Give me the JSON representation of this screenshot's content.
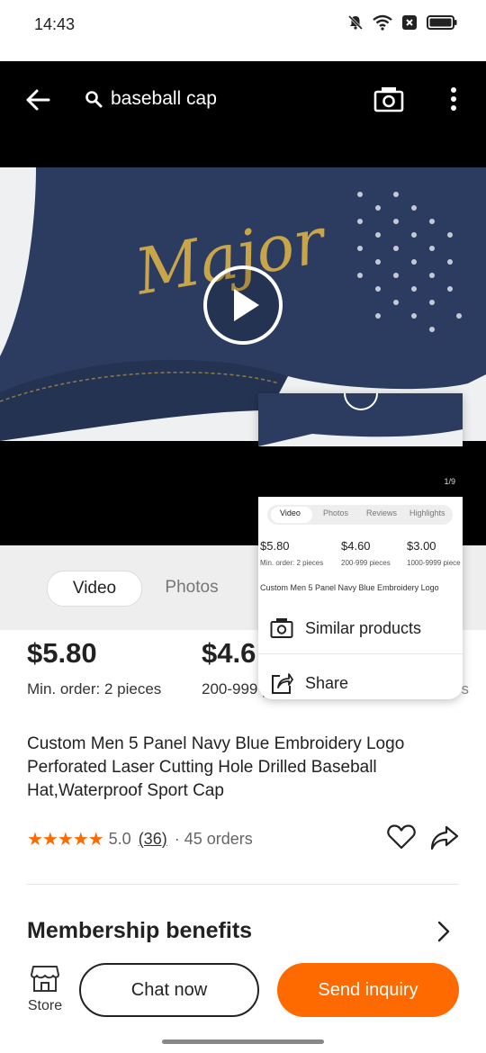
{
  "status_bar": {
    "time": "14:43"
  },
  "search": {
    "query": "baseball cap"
  },
  "hero": {
    "script_text": "Major",
    "page_indicator": "1/9"
  },
  "tabs": {
    "video": "Video",
    "photos": "Photos"
  },
  "prices": [
    {
      "price": "$5.80",
      "note": "Min. order: 2 pieces"
    },
    {
      "price": "$4.6",
      "note": "200-999 p"
    }
  ],
  "trailing_text": "es",
  "product": {
    "title": "Custom Men 5 Panel Navy Blue Embroidery Logo Perforated Laser Cutting Hole Drilled Baseball Hat,Waterproof Sport Cap",
    "stars": "★★★★★",
    "rating": "5.0",
    "reviews": "(36)",
    "orders": "· 45 orders"
  },
  "membership": {
    "label": "Membership benefits"
  },
  "bottom": {
    "store_label": "Store",
    "chat_label": "Chat now",
    "inquiry_label": "Send inquiry"
  },
  "popup": {
    "preview_tabs": [
      "Video",
      "Photos",
      "Reviews",
      "Highlights"
    ],
    "preview_prices": [
      {
        "price": "$5.80",
        "note": "Min. order: 2 pieces"
      },
      {
        "price": "$4.60",
        "note": "200-999 pieces"
      },
      {
        "price": "$3.00",
        "note": "1000-9999 piece"
      }
    ],
    "preview_title": "Custom Men 5 Panel Navy Blue Embroidery Logo",
    "menu": {
      "similar": "Similar products",
      "share": "Share"
    }
  },
  "colors": {
    "accent": "#ff6a00",
    "cap_navy": "#2a3b5e",
    "embroidery_gold": "#c9a54a"
  }
}
